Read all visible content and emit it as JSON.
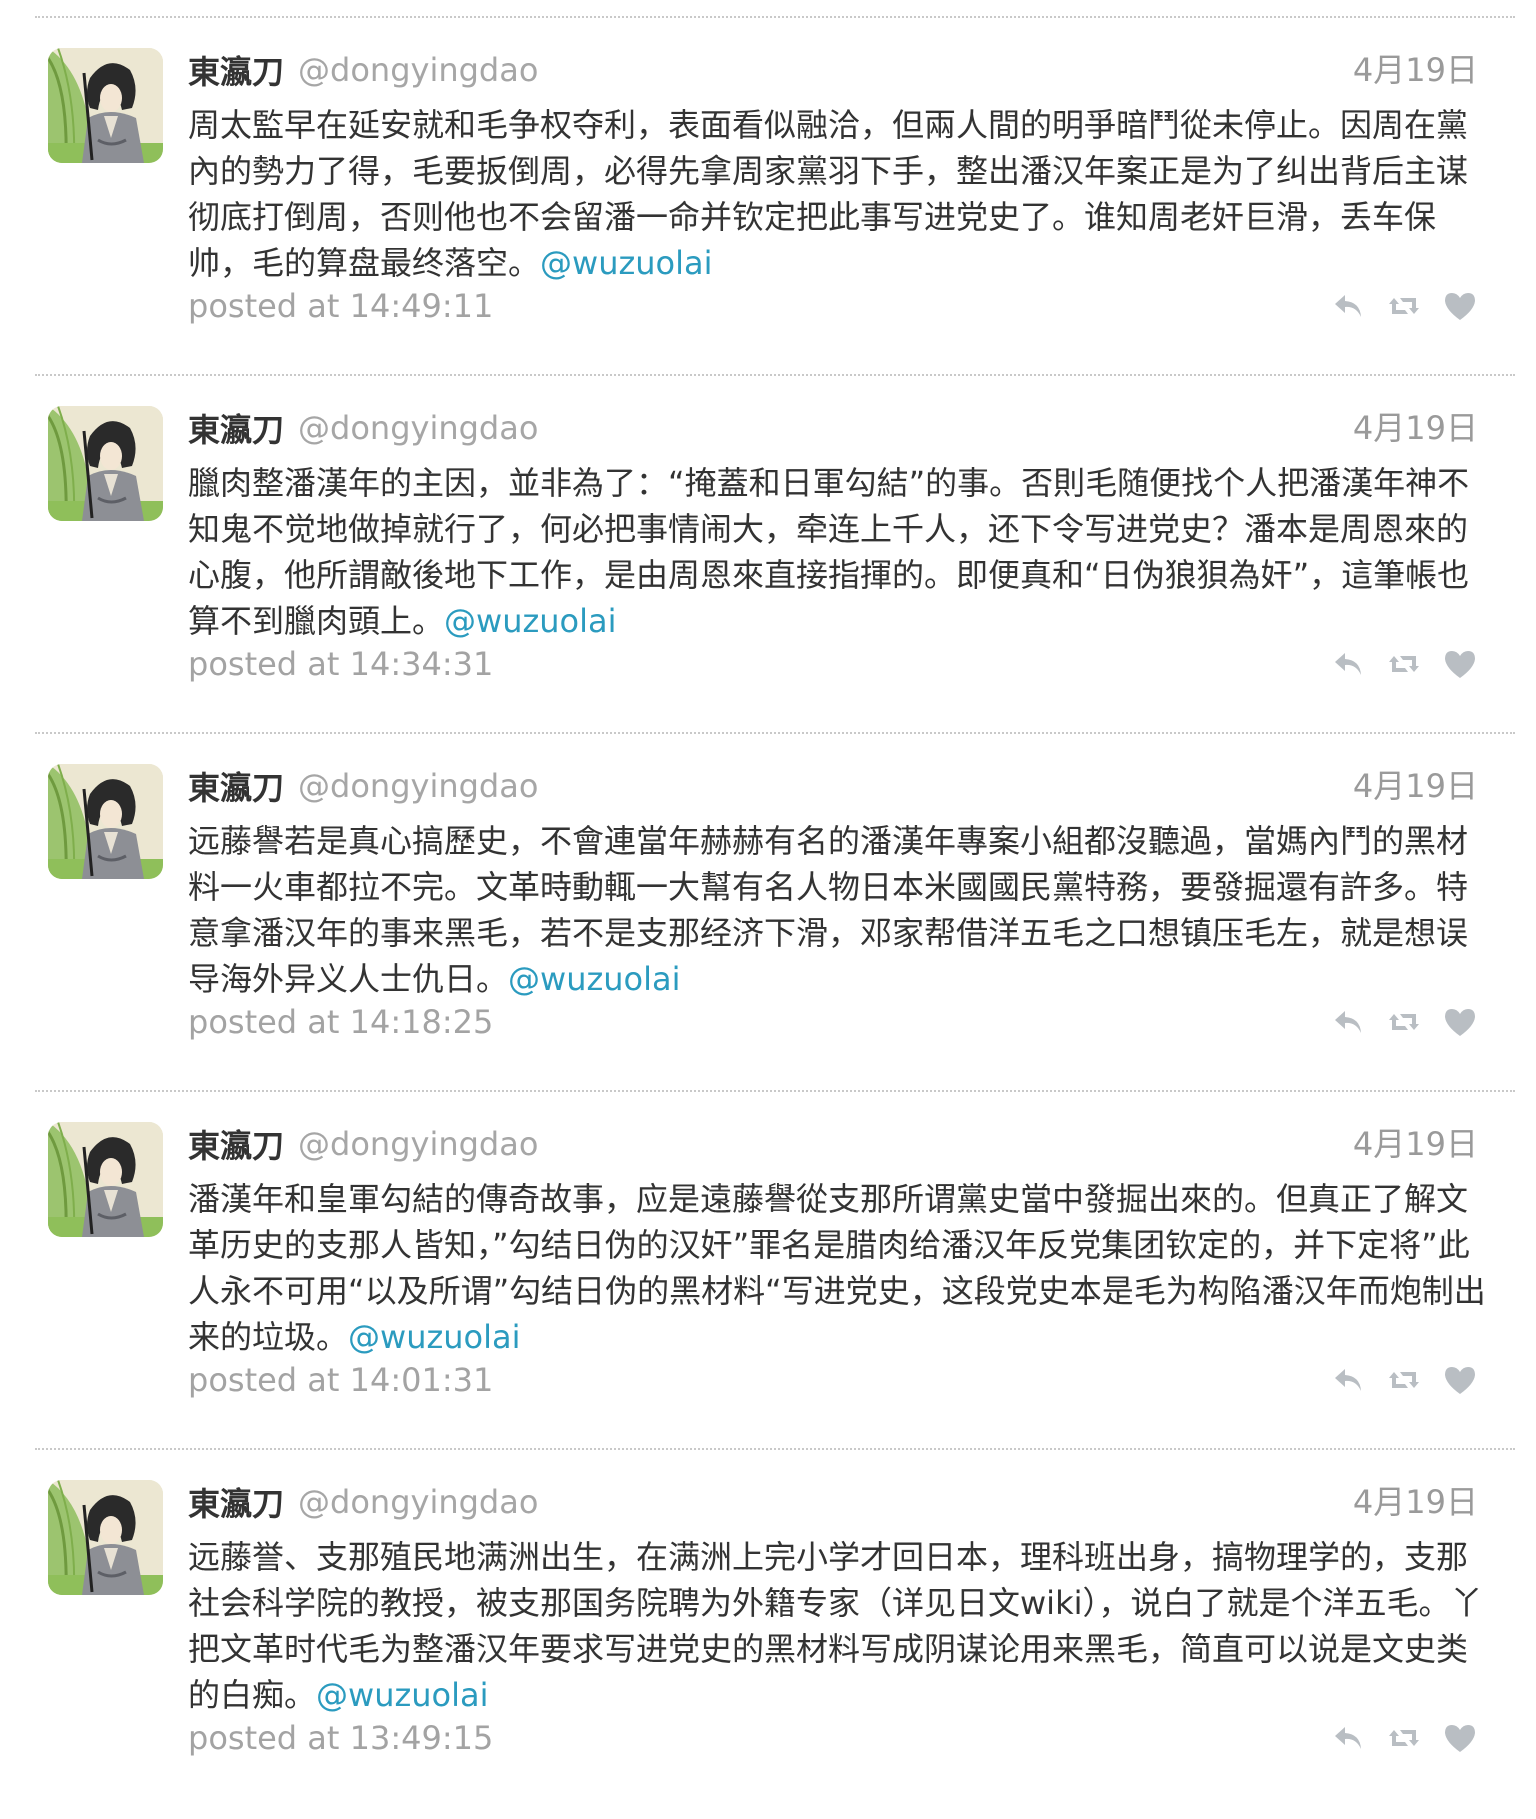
{
  "tweets": [
    {
      "display_name": "東瀛刀",
      "handle": "@dongyingdao",
      "date": "4月19日",
      "text": "周太監早在延安就和毛争权夺利，表面看似融洽，但兩人間的明爭暗鬥從未停止。因周在黨內的勢力了得，毛要扳倒周，必得先拿周家黨羽下手，整出潘汉年案正是为了纠出背后主谋彻底打倒周，否则他也不会留潘一命并钦定把此事写进党史了。谁知周老奸巨滑，丢车保帅，毛的算盘最终落空。",
      "mention": "@wuzuolai",
      "posted": "posted at 14:49:11"
    },
    {
      "display_name": "東瀛刀",
      "handle": "@dongyingdao",
      "date": "4月19日",
      "text": "臘肉整潘漢年的主因，並非為了：“掩蓋和日軍勾結”的事。否則毛随便找个人把潘漢年神不知鬼不觉地做掉就行了，何必把事情闹大，牵连上千人，还下令写进党史？潘本是周恩來的心腹，他所謂敵後地下工作，是由周恩來直接指揮的。即便真和“日伪狼狽為奸”，這筆帳也算不到臘肉頭上。",
      "mention": "@wuzuolai",
      "posted": "posted at 14:34:31"
    },
    {
      "display_name": "東瀛刀",
      "handle": "@dongyingdao",
      "date": "4月19日",
      "text": "远藤譽若是真心搞歷史，不會連當年赫赫有名的潘漢年專案小組都沒聽過，當媽內鬥的黑材料一火車都拉不完。文革時動輒一大幫有名人物日本米國國民黨特務，要發掘還有許多。特意拿潘汉年的事来黑毛，若不是支那经济下滑，邓家帮借洋五毛之口想镇压毛左，就是想误导海外异义人士仇日。",
      "mention": "@wuzuolai",
      "posted": "posted at 14:18:25"
    },
    {
      "display_name": "東瀛刀",
      "handle": "@dongyingdao",
      "date": "4月19日",
      "text": "潘漢年和皇軍勾結的傳奇故事，应是遠藤譽從支那所谓黨史當中發掘出來的。但真正了解文革历史的支那人皆知，”勾结日伪的汉奸”罪名是腊肉给潘汉年反党集团钦定的，并下定将”此人永不可用“以及所谓”勾结日伪的黑材料“写进党史，这段党史本是毛为构陷潘汉年而炮制出来的垃圾。",
      "mention": "@wuzuolai",
      "posted": "posted at 14:01:31"
    },
    {
      "display_name": "東瀛刀",
      "handle": "@dongyingdao",
      "date": "4月19日",
      "text": "远藤誉、支那殖民地满洲出生，在满洲上完小学才回日本，理科班出身，搞物理学的，支那社会科学院的教授，被支那国务院聘为外籍专家（详见日文wiki），说白了就是个洋五毛。丫把文革时代毛为整潘汉年要求写进党史的黑材料写成阴谋论用来黑毛，简直可以说是文史类的白痴。",
      "mention": "@wuzuolai",
      "posted": "posted at 13:49:15"
    }
  ],
  "icons": {
    "reply": "reply-icon",
    "retweet": "retweet-icon",
    "favorite": "heart-icon"
  },
  "colors": {
    "mention": "#2b9bbf",
    "meta": "#a3a3a3",
    "icon": "#b9bec3"
  }
}
